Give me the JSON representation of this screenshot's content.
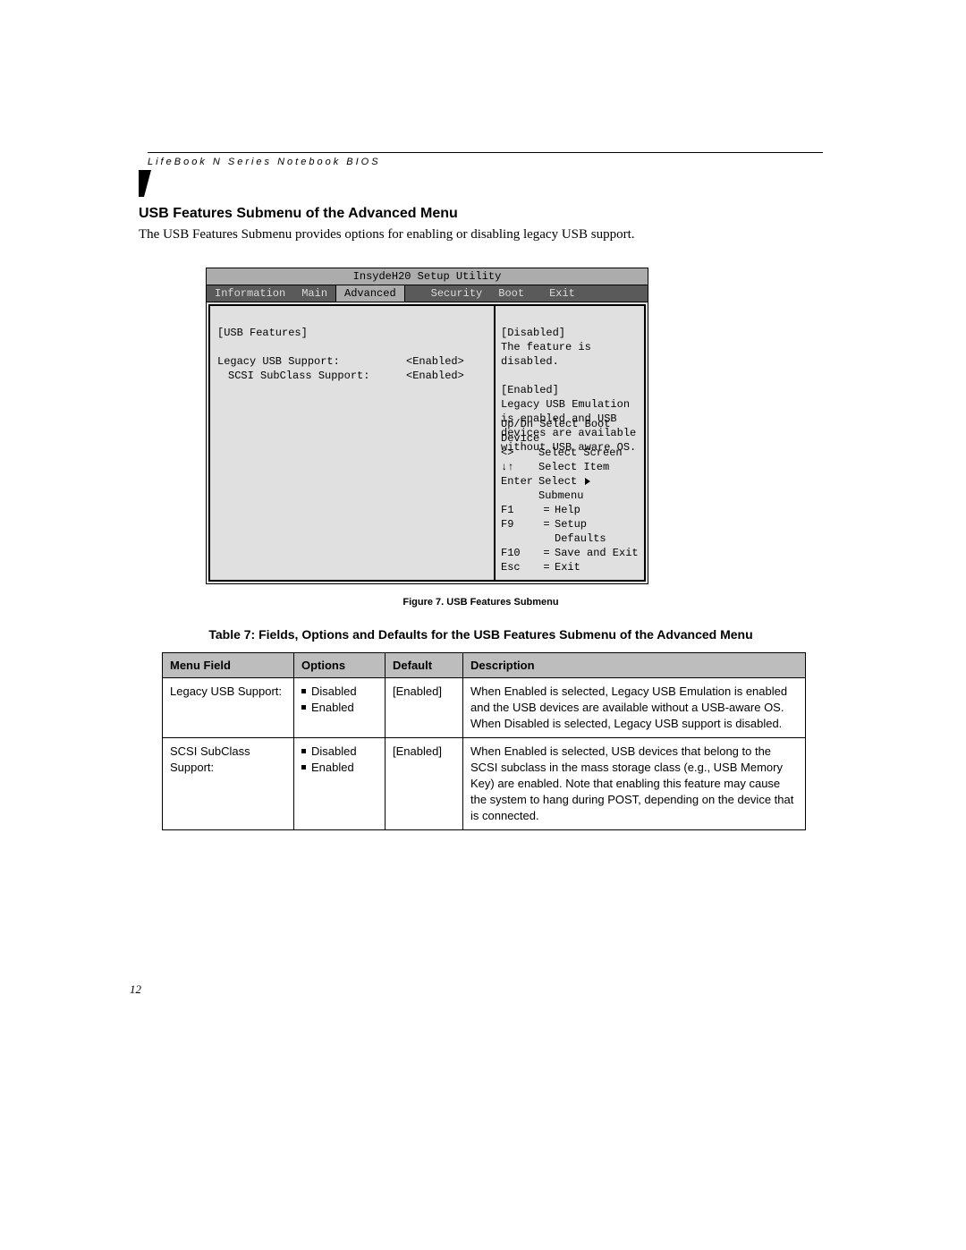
{
  "header": {
    "running_head": "LifeBook N Series Notebook BIOS"
  },
  "section": {
    "title": "USB Features Submenu of the Advanced Menu",
    "intro": "The USB Features Submenu provides options for enabling or disabling legacy USB support."
  },
  "bios": {
    "utility_title": "InsydeH20 Setup Utility",
    "tabs": {
      "information": "Information",
      "main": "Main",
      "advanced": "Advanced",
      "security": "Security",
      "boot": "Boot",
      "exit": "Exit"
    },
    "left": {
      "group": "[USB Features]",
      "legacy_label": "Legacy USB Support:",
      "legacy_value": "<Enabled>",
      "scsi_label": "SCSI SubClass Support:",
      "scsi_value": "<Enabled>"
    },
    "right": {
      "disabled_head": "[Disabled]",
      "disabled_text": "The feature is disabled.",
      "enabled_head": "[Enabled]",
      "enabled_text": "Legacy USB Emulation is enabled and USB devices are available without USB aware OS."
    },
    "nav": {
      "updn": "Up/Dn Select Boot Device",
      "lr_key": "<>",
      "lr_txt": "Select Screen",
      "ud_key": "↓↑",
      "ud_txt": "Select Item",
      "enter_key": "Enter",
      "enter_txt_a": "Select",
      "enter_txt_b": "Submenu",
      "f1_key": "F1",
      "f1_txt": "Help",
      "f9_key": "F9",
      "f9_txt": "Setup Defaults",
      "f10_key": "F10",
      "f10_txt": "Save and Exit",
      "esc_key": "Esc",
      "esc_txt": "Exit",
      "eq": "="
    }
  },
  "figure_caption": "Figure 7.  USB Features Submenu",
  "table": {
    "title": "Table 7: Fields, Options and Defaults for the USB Features Submenu of the Advanced Menu",
    "headers": {
      "menu_field": "Menu Field",
      "options": "Options",
      "default": "Default",
      "description": "Description"
    },
    "rows": [
      {
        "field": "Legacy USB Support:",
        "opts": [
          "Disabled",
          "Enabled"
        ],
        "default": "[Enabled]",
        "desc": "When Enabled is selected, Legacy USB Emulation is enabled and the USB devices are available without a USB-aware OS. When Disabled is selected, Legacy USB support is disabled."
      },
      {
        "field": "SCSI SubClass Support:",
        "opts": [
          "Disabled",
          "Enabled"
        ],
        "default": "[Enabled]",
        "desc": "When Enabled is selected, USB devices that belong to the SCSI subclass in the mass storage class (e.g., USB Memory Key) are enabled. Note that enabling this feature may cause the system to hang during POST, depending on the device that is connected."
      }
    ]
  },
  "page_number": "12"
}
